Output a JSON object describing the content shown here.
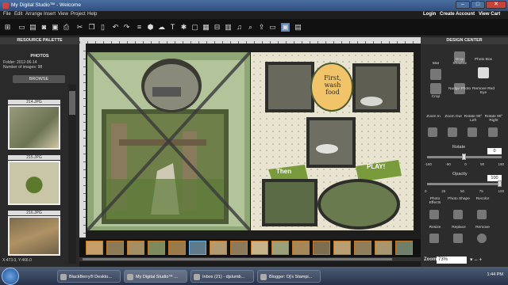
{
  "window": {
    "title": "My Digital Studio™ - Welcome"
  },
  "menu": {
    "items": [
      "File",
      "Edit",
      "Arrange",
      "Insert",
      "View",
      "Project",
      "Help"
    ],
    "right": [
      "Login",
      "Create Account",
      "View Cart"
    ]
  },
  "brand": {
    "name": "mds",
    "version": "2"
  },
  "left_panel": {
    "title": "RESOURCE PALETTE",
    "section": "PHOTOS",
    "folder": "Folder: 2012-06-14",
    "count": "Number of images: 98",
    "browse_label": "BROWSE",
    "thumbs": [
      "214.JPG",
      "215.JPG",
      "216.JPG"
    ],
    "coords": "X:473.0, Y:466.0"
  },
  "canvas": {
    "labels": {
      "first": "First,",
      "wash": "wash",
      "food": "food",
      "then": "Then",
      "play": "PLAY!"
    }
  },
  "design_center": {
    "title": "DESIGN CENTER",
    "row1": [
      "Mat",
      "Drop Shadow",
      "Photo Box"
    ],
    "row2": [
      "Crop",
      "Nudge Photo",
      "Remove Red Eye"
    ],
    "row3": [
      "Zoom In",
      "Zoom Out",
      "Rotate 90° Left",
      "Rotate 90° Right"
    ],
    "rotate_label": "Rotate",
    "rotate_value": "0",
    "rotate_ticks": [
      "-180",
      "-90",
      "0",
      "90",
      "180"
    ],
    "opacity_label": "Opacity",
    "opacity_value": "100",
    "opacity_ticks": [
      "0",
      "25",
      "50",
      "75",
      "100"
    ],
    "row4": [
      "Photo Effects",
      "Photo Shape",
      "Recolor"
    ],
    "row5": [
      "Resize",
      "Replace",
      "Remove"
    ],
    "zoom_label": "Zoom:",
    "zoom_value": "73%"
  },
  "taskbar": {
    "tasks": [
      "BlackBerry® Deskto...",
      "My Digital Studio™ ...",
      "Inbox (21) - djslumb...",
      "Blogger: Dj's Stampi..."
    ],
    "clock": "1:44 PM"
  }
}
